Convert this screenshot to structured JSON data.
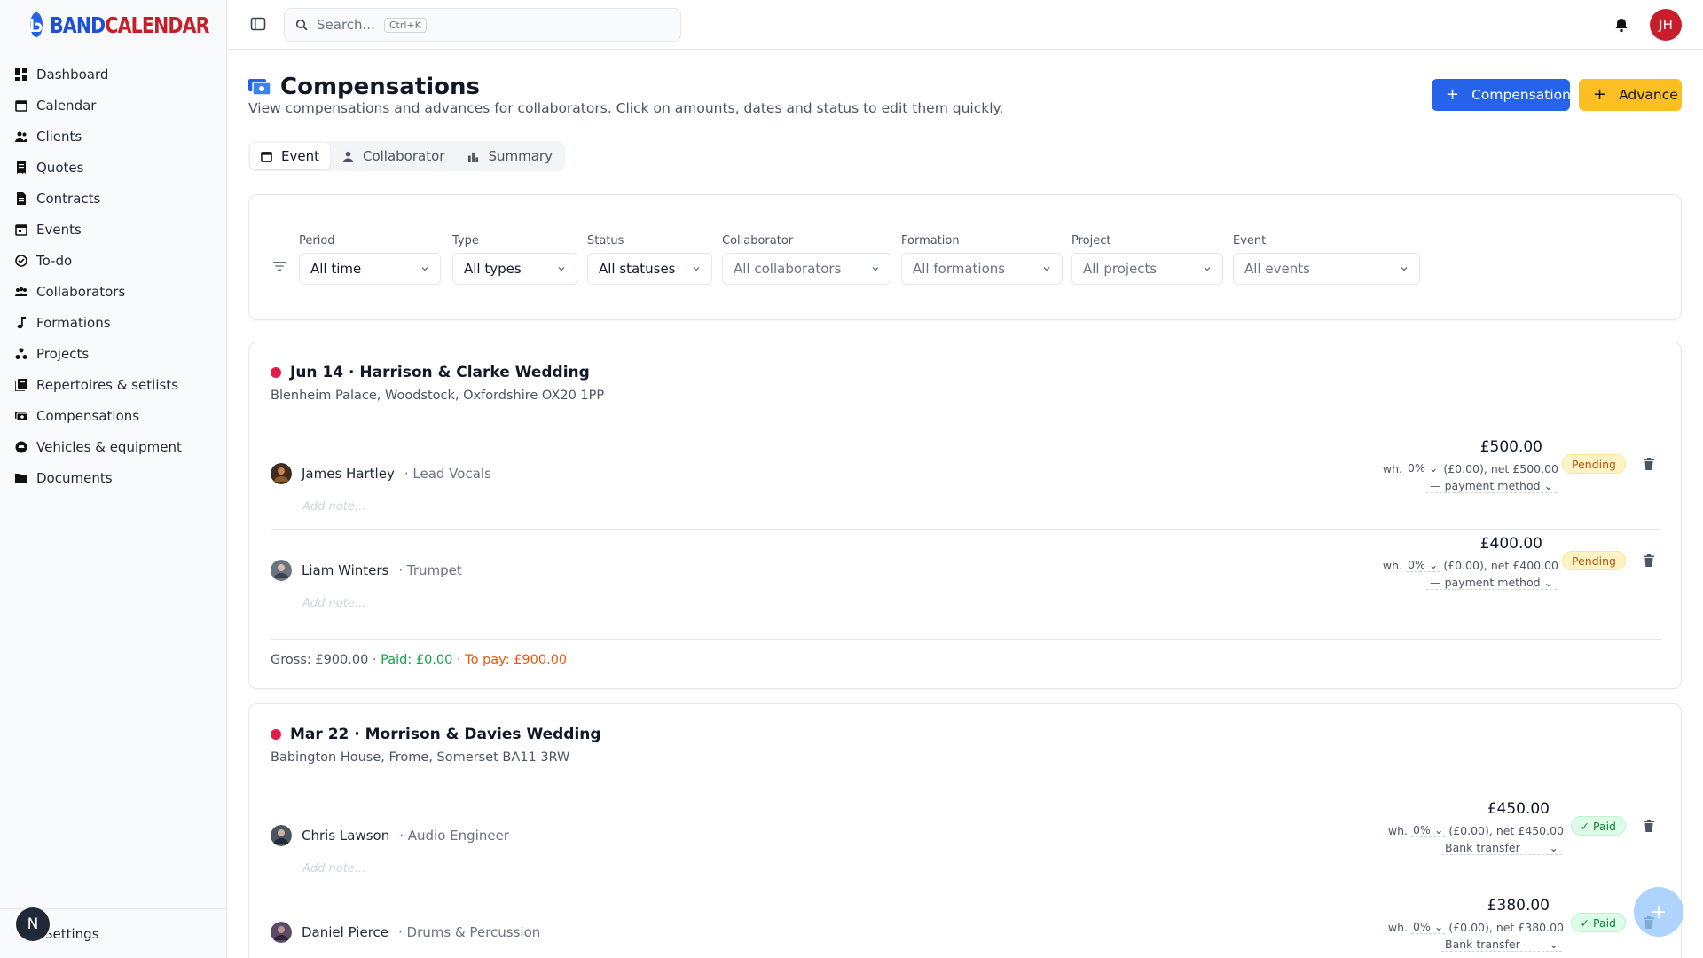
{
  "app": {
    "logo": "BANDCALENDAR"
  },
  "colors": {
    "accent": "#2563eb",
    "brand_red": "#c81e2b",
    "amber": "#fbbf24",
    "event_dot": "#e11d48"
  },
  "sidebar": {
    "items": [
      {
        "label": "Dashboard",
        "icon": "dashboard-icon"
      },
      {
        "label": "Calendar",
        "icon": "calendar-icon"
      },
      {
        "label": "Clients",
        "icon": "users-icon"
      },
      {
        "label": "Quotes",
        "icon": "receipt-icon"
      },
      {
        "label": "Contracts",
        "icon": "file-icon"
      },
      {
        "label": "Events",
        "icon": "calendar-event-icon"
      },
      {
        "label": "To-do",
        "icon": "check-circle-icon"
      },
      {
        "label": "Collaborators",
        "icon": "group-icon"
      },
      {
        "label": "Formations",
        "icon": "music-note-icon"
      },
      {
        "label": "Projects",
        "icon": "projects-icon"
      },
      {
        "label": "Repertoires & setlists",
        "icon": "library-icon"
      },
      {
        "label": "Compensations",
        "icon": "money-icon"
      },
      {
        "label": "Vehicles & equipment",
        "icon": "vehicle-icon"
      },
      {
        "label": "Documents",
        "icon": "folder-icon"
      }
    ],
    "settings_label": "Settings",
    "badge_letter": "N"
  },
  "header": {
    "search_placeholder": "Search...",
    "search_shortcut": "Ctrl+K",
    "user_initials": "JH"
  },
  "page": {
    "title": "Compensations",
    "subtitle": "View compensations and advances for collaborators. Click on amounts, dates and status to edit them quickly.",
    "add_compensation": "Compensation",
    "add_advance": "Advance",
    "tabs": [
      {
        "label": "Event",
        "active": true
      },
      {
        "label": "Collaborator",
        "active": false
      },
      {
        "label": "Summary",
        "active": false
      }
    ]
  },
  "filters": [
    {
      "label": "Period",
      "value": "All time"
    },
    {
      "label": "Type",
      "value": "All types"
    },
    {
      "label": "Status",
      "value": "All statuses"
    },
    {
      "label": "Collaborator",
      "value": "All collaborators"
    },
    {
      "label": "Formation",
      "value": "All formations"
    },
    {
      "label": "Project",
      "value": "All projects"
    },
    {
      "label": "Event",
      "value": "All events"
    }
  ],
  "events": [
    {
      "title": "Jun 14 · Harrison & Clarke Wedding",
      "location": "Blenheim Palace, Woodstock, Oxfordshire OX20 1PP",
      "rows": [
        {
          "name": "James Hartley",
          "role": "· Lead Vocals",
          "amount": "£500.00",
          "wh_label": "wh.",
          "wh_pct": "0%",
          "wh_detail": "(£0.00), net £500.00",
          "method": "— payment method",
          "status": "Pending",
          "note_placeholder": "Add note..."
        },
        {
          "name": "Liam Winters",
          "role": "· Trumpet",
          "amount": "£400.00",
          "wh_label": "wh.",
          "wh_pct": "0%",
          "wh_detail": "(£0.00), net £400.00",
          "method": "— payment method",
          "status": "Pending",
          "note_placeholder": "Add note..."
        }
      ],
      "totals": {
        "gross": "Gross: £900.00 ·",
        "paid": "Paid: £0.00",
        "sep": "·",
        "to_pay": "To pay: £900.00"
      }
    },
    {
      "title": "Mar 22 · Morrison & Davies Wedding",
      "location": "Babington House, Frome, Somerset BA11 3RW",
      "rows": [
        {
          "name": "Chris Lawson",
          "role": "· Audio Engineer",
          "amount": "£450.00",
          "wh_label": "wh.",
          "wh_pct": "0%",
          "wh_detail": "(£0.00), net £450.00",
          "method": "Bank transfer",
          "status": "✓ Paid",
          "note_placeholder": "Add note..."
        },
        {
          "name": "Daniel Pierce",
          "role": "· Drums & Percussion",
          "amount": "£380.00",
          "wh_label": "wh.",
          "wh_pct": "0%",
          "wh_detail": "(£0.00), net £380.00",
          "method": "Bank transfer",
          "status": "✓ Paid"
        }
      ]
    }
  ]
}
